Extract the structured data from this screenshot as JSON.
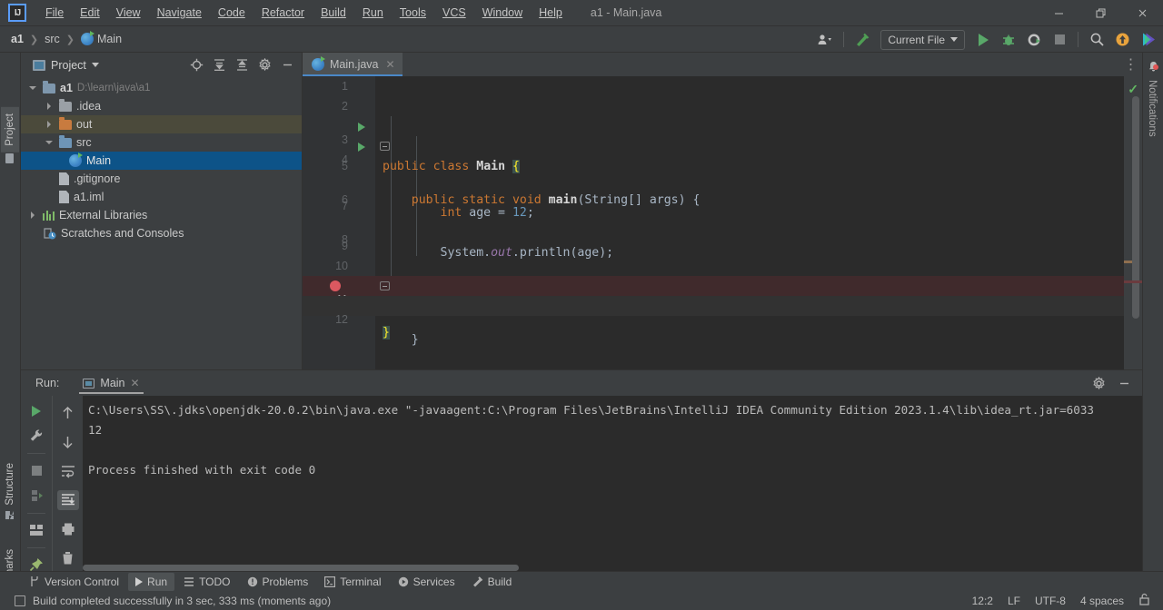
{
  "window": {
    "title": "a1 - Main.java",
    "logo": "intellij-idea-logo",
    "minimize": "minimize-icon",
    "maximize": "maximize-icon",
    "close": "close-icon"
  },
  "menu": {
    "items": [
      {
        "label": "File"
      },
      {
        "label": "Edit"
      },
      {
        "label": "View"
      },
      {
        "label": "Navigate"
      },
      {
        "label": "Code"
      },
      {
        "label": "Refactor"
      },
      {
        "label": "Build"
      },
      {
        "label": "Run"
      },
      {
        "label": "Tools"
      },
      {
        "label": "VCS"
      },
      {
        "label": "Window"
      },
      {
        "label": "Help"
      }
    ]
  },
  "breadcrumb": {
    "project": "a1",
    "folder": "src",
    "file": "Main"
  },
  "toolbar": {
    "run_config": "Current File",
    "icons": [
      "user-avatar-icon",
      "build-hammer-icon",
      "run-icon",
      "debug-icon",
      "run-with-coverage-icon",
      "stop-icon",
      "search-everywhere-icon",
      "update-project-icon",
      "ai-assistant-icon"
    ]
  },
  "left_stripe": {
    "project": "Project",
    "structure": "Structure",
    "bookmarks": "Bookmarks"
  },
  "right_stripe": {
    "notifications": "Notifications"
  },
  "project_panel": {
    "title": "Project",
    "actions": [
      "locate-icon",
      "expand-all-icon",
      "collapse-all-icon",
      "settings-gear-icon",
      "hide-icon"
    ],
    "tree": [
      {
        "label": "a1",
        "path": "D:\\learn\\java\\a1",
        "icon": "module-folder-icon",
        "arrow": "down",
        "indent": 0,
        "state": "normal"
      },
      {
        "label": ".idea",
        "path": "",
        "icon": "folder-grey-icon",
        "arrow": "right",
        "indent": 1,
        "state": "normal"
      },
      {
        "label": "out",
        "path": "",
        "icon": "folder-orange-icon",
        "arrow": "right",
        "indent": 1,
        "state": "highlight"
      },
      {
        "label": "src",
        "path": "",
        "icon": "folder-source-icon",
        "arrow": "down",
        "indent": 1,
        "state": "normal"
      },
      {
        "label": "Main",
        "path": "",
        "icon": "java-class-icon",
        "arrow": "none",
        "indent": 2,
        "state": "selected"
      },
      {
        "label": ".gitignore",
        "path": "",
        "icon": "gitignore-file-icon",
        "arrow": "none",
        "indent": 1,
        "state": "normal"
      },
      {
        "label": "a1.iml",
        "path": "",
        "icon": "iml-file-icon",
        "arrow": "none",
        "indent": 1,
        "state": "normal"
      },
      {
        "label": "External Libraries",
        "path": "",
        "icon": "libraries-icon",
        "arrow": "right",
        "indent": 0,
        "state": "normal"
      },
      {
        "label": "Scratches and Consoles",
        "path": "",
        "icon": "scratches-icon",
        "arrow": "none",
        "indent": 0,
        "state": "normal"
      }
    ]
  },
  "editor": {
    "tab": {
      "label": "Main.java",
      "icon": "java-class-icon",
      "close": "close-tab-icon"
    },
    "options_icon": "editor-options-icon",
    "inspection_status": "no-errors-check-icon",
    "lines": [
      {
        "no": "1",
        "tokens": []
      },
      {
        "no": "2",
        "tokens": []
      },
      {
        "no": "3",
        "tokens": [
          {
            "t": "public",
            "c": "kw"
          },
          {
            "t": " ",
            "c": "plain"
          },
          {
            "t": "class",
            "c": "kw"
          },
          {
            "t": " ",
            "c": "plain"
          },
          {
            "t": "Main",
            "c": "id-b"
          },
          {
            "t": " ",
            "c": "plain"
          },
          {
            "t": "{",
            "c": "brace-hl"
          }
        ],
        "gutter_run": true,
        "indent": 0
      },
      {
        "no": "4",
        "tokens": [
          {
            "t": "    ",
            "c": "plain"
          },
          {
            "t": "public",
            "c": "kw"
          },
          {
            "t": " ",
            "c": "plain"
          },
          {
            "t": "static",
            "c": "kw"
          },
          {
            "t": " ",
            "c": "plain"
          },
          {
            "t": "void",
            "c": "kw"
          },
          {
            "t": " ",
            "c": "plain"
          },
          {
            "t": "main",
            "c": "id-b"
          },
          {
            "t": "(String[] args) {",
            "c": "plain"
          }
        ],
        "gutter_run": true,
        "fold": true,
        "indent": 0
      },
      {
        "no": "5",
        "tokens": []
      },
      {
        "no": "6",
        "tokens": [
          {
            "t": "        ",
            "c": "plain"
          },
          {
            "t": "int",
            "c": "kw"
          },
          {
            "t": " age = ",
            "c": "plain"
          },
          {
            "t": "12",
            "c": "num"
          },
          {
            "t": ";",
            "c": "plain"
          }
        ]
      },
      {
        "no": "7",
        "tokens": []
      },
      {
        "no": "8",
        "tokens": [
          {
            "t": "        System.",
            "c": "plain"
          },
          {
            "t": "out",
            "c": "st-field"
          },
          {
            "t": ".println(age);",
            "c": "plain"
          }
        ]
      },
      {
        "no": "9",
        "tokens": []
      },
      {
        "no": "10",
        "tokens": []
      },
      {
        "no": "11",
        "tokens": [
          {
            "t": "    }",
            "c": "plain"
          }
        ],
        "breakpoint": true,
        "fold": true
      },
      {
        "no": "12",
        "tokens": [
          {
            "t": "}",
            "c": "brace-hl"
          }
        ],
        "caret": true
      }
    ]
  },
  "run_panel": {
    "label": "Run:",
    "tab": "Main",
    "tab_close": "close-icon",
    "settings_icon": "settings-gear-icon",
    "minimize_icon": "minimize-icon",
    "left_actions": [
      "rerun-icon",
      "wrench-settings-icon",
      "stop-icon",
      "rerun-failed-tests-icon",
      "layout-icon",
      "pin-icon"
    ],
    "right_actions": [
      "up-arrow-icon",
      "down-arrow-icon",
      "soft-wrap-icon",
      "scroll-to-end-icon",
      "print-icon",
      "trash-icon"
    ],
    "console": [
      "C:\\Users\\SS\\.jdks\\openjdk-20.0.2\\bin\\java.exe \"-javaagent:C:\\Program Files\\JetBrains\\IntelliJ IDEA Community Edition 2023.1.4\\lib\\idea_rt.jar=6033",
      "12",
      "",
      "Process finished with exit code 0"
    ]
  },
  "bottom_tabs": [
    {
      "label": "Version Control",
      "icon": "vcs-branch-icon",
      "active": false
    },
    {
      "label": "Run",
      "icon": "run-icon",
      "active": true
    },
    {
      "label": "TODO",
      "icon": "todo-list-icon",
      "active": false
    },
    {
      "label": "Problems",
      "icon": "problems-icon",
      "active": false
    },
    {
      "label": "Terminal",
      "icon": "terminal-icon",
      "active": false
    },
    {
      "label": "Services",
      "icon": "services-icon",
      "active": false
    },
    {
      "label": "Build",
      "icon": "build-hammer-icon",
      "active": false
    }
  ],
  "status_bar": {
    "message": "Build completed successfully in 3 sec, 333 ms (moments ago)",
    "status_icon": "build-status-icon",
    "caret_position": "12:2",
    "line_separator": "LF",
    "encoding": "UTF-8",
    "indent": "4 spaces",
    "lock_icon": "unlocked-icon"
  },
  "colors": {
    "accent_blue": "#4a88c7",
    "selection_blue": "#0d5388",
    "run_green": "#59a869",
    "breakpoint_red": "#db5860",
    "keyword_orange": "#cc7832",
    "number_blue": "#6897bb",
    "bg_panel": "#3c3f41",
    "bg_editor": "#2b2b2b"
  }
}
